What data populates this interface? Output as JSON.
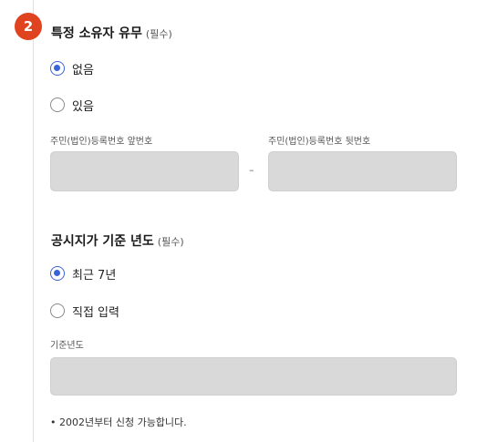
{
  "step": {
    "number": "2"
  },
  "owner_section": {
    "title": "특정 소유자 유무",
    "required": "(필수)",
    "options": [
      {
        "label": "없음",
        "checked": true
      },
      {
        "label": "있음",
        "checked": false
      }
    ],
    "front_label": "주민(법인)등록번호 앞번호",
    "back_label": "주민(법인)등록번호 뒷번호",
    "front_value": "",
    "back_value": "",
    "separator": "–"
  },
  "year_section": {
    "title": "공시지가 기준 년도",
    "required": "(필수)",
    "options": [
      {
        "label": "최근 7년",
        "checked": true
      },
      {
        "label": "직접 입력",
        "checked": false
      }
    ],
    "year_label": "기준년도",
    "year_value": "",
    "note": "• 2002년부터 신청 가능합니다."
  },
  "colors": {
    "badge": "#e0431f",
    "radio_accent": "#3b63d8",
    "input_bg": "#d9d9d9"
  }
}
